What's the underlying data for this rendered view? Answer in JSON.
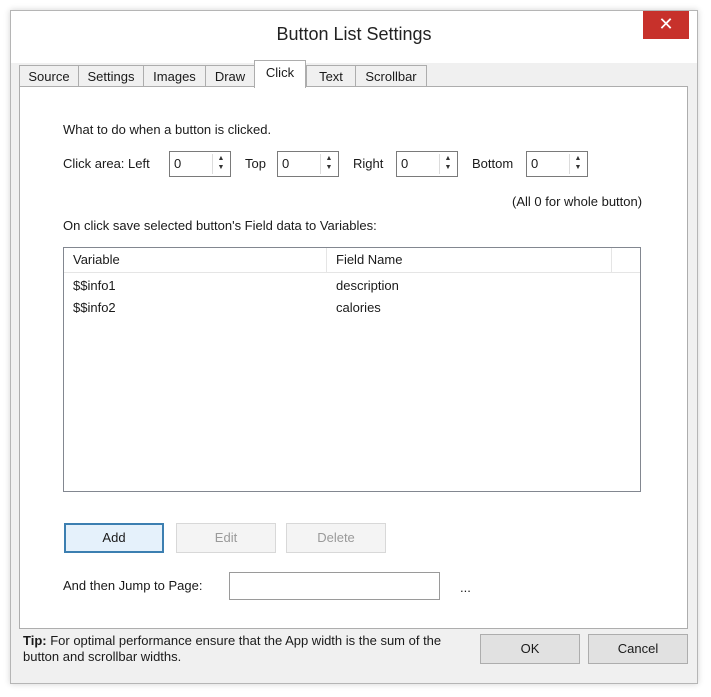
{
  "window": {
    "title": "Button List Settings",
    "close_symbol": "✕"
  },
  "tabs": [
    {
      "label": "Source"
    },
    {
      "label": "Settings"
    },
    {
      "label": "Images"
    },
    {
      "label": "Draw"
    },
    {
      "label": "Click"
    },
    {
      "label": "Text"
    },
    {
      "label": "Scrollbar"
    }
  ],
  "active_tab": "Click",
  "panel": {
    "intro": "What to do when a button is clicked.",
    "click_area_label": "Click area: Left",
    "left_value": "0",
    "top_label": "Top",
    "top_value": "0",
    "right_label": "Right",
    "right_value": "0",
    "bottom_label": "Bottom",
    "bottom_value": "0",
    "hint": "(All 0 for whole button)",
    "save_label": "On click save selected button's Field data to Variables:",
    "columns": [
      "Variable",
      "Field Name"
    ],
    "rows": [
      {
        "variable": "$$info1",
        "field": "description"
      },
      {
        "variable": "$$info2",
        "field": "calories"
      }
    ],
    "add_label": "Add",
    "edit_label": "Edit",
    "delete_label": "Delete",
    "jump_label": "And then Jump to Page:",
    "jump_value": "",
    "browse_label": "..."
  },
  "footer": {
    "tip_label": "Tip:",
    "tip_text": "For optimal performance ensure that the App width is the sum of the button and scrollbar widths.",
    "ok_label": "OK",
    "cancel_label": "Cancel"
  }
}
